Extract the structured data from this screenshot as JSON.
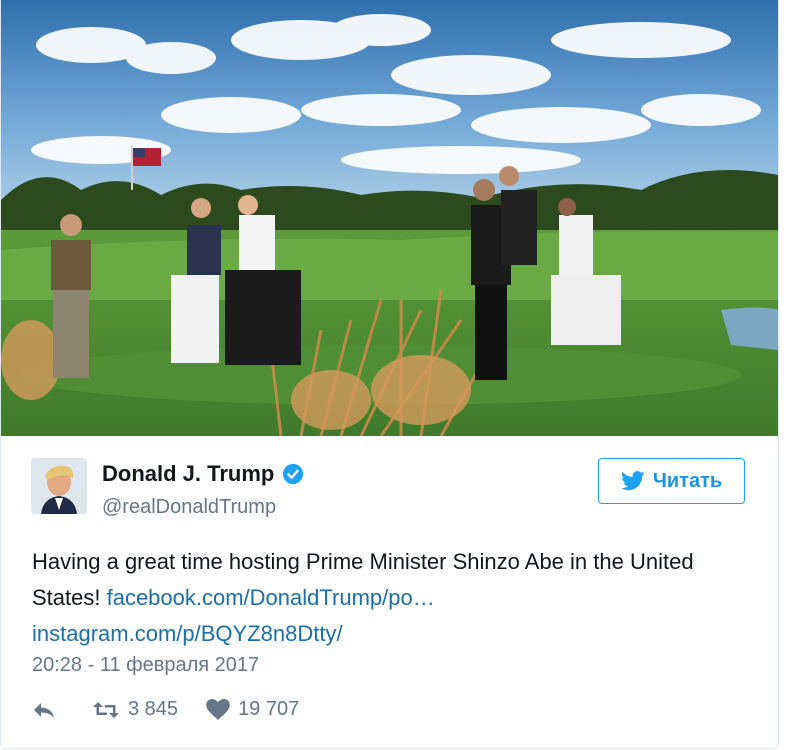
{
  "tweet": {
    "display_name": "Donald J. Trump",
    "handle": "@realDonaldTrump",
    "follow_label": "Читать",
    "text_plain": "Having a great time hosting Prime Minister Shinzo Abe in the United States! ",
    "link_facebook": "facebook.com/DonaldTrump/po…",
    "link_instagram": "instagram.com/p/BQYZ8n8Dtty/",
    "timestamp": "20:28 - 11 февраля 2017",
    "retweets": "3 845",
    "likes": "19 707"
  },
  "icons": {
    "verified": "verified-badge-icon",
    "follow": "twitter-bird-icon",
    "reply": "reply-icon",
    "retweet": "retweet-icon",
    "like": "heart-icon"
  },
  "colors": {
    "accent": "#1da1f2",
    "link": "#1b6fa8",
    "muted": "#657786",
    "text": "#14171a"
  }
}
